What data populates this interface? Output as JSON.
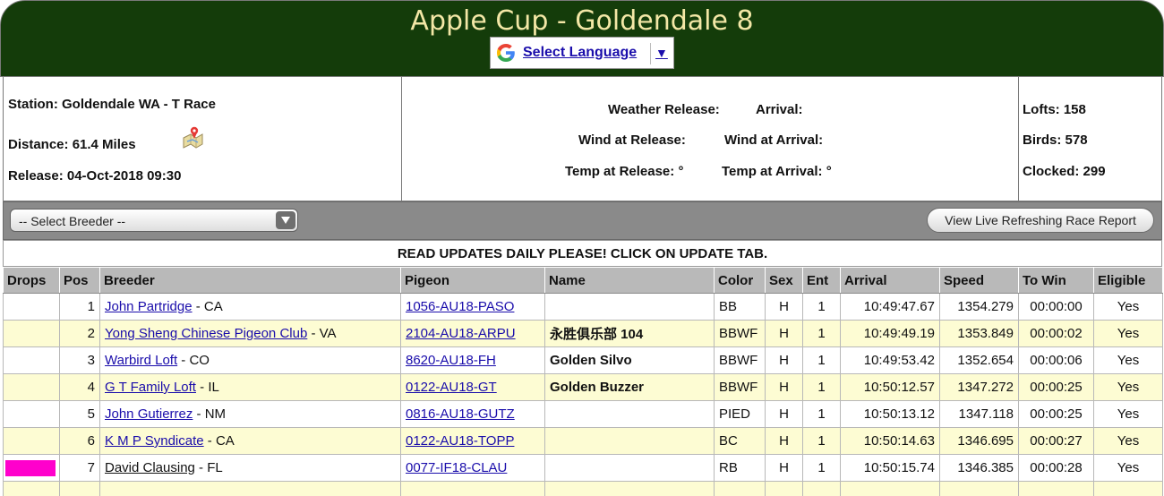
{
  "header": {
    "title": "Apple Cup - Goldendale 8",
    "language_label": "Select Language",
    "language_arrow": "▼"
  },
  "race_info": {
    "station": "Station: Goldendale WA - T Race",
    "distance": "Distance: 61.4 Miles",
    "release": "Release: 04-Oct-2018 09:30",
    "weather_release": "Weather Release:",
    "arrival": "Arrival:",
    "wind_release": "Wind at Release:",
    "wind_arrival": "Wind at Arrival:",
    "temp_release": "Temp at Release: °",
    "temp_arrival": "Temp at Arrival: °",
    "lofts": "Lofts: 158",
    "birds": "Birds: 578",
    "clocked": "Clocked: 299"
  },
  "toolbar": {
    "breeder_select": "-- Select Breeder --",
    "live_report_button": "View Live Refreshing Race Report"
  },
  "notice": "READ UPDATES DAILY PLEASE! CLICK ON UPDATE TAB.",
  "table": {
    "columns": [
      "Drops",
      "Pos",
      "Breeder",
      "Pigeon",
      "Name",
      "Color",
      "Sex",
      "Ent",
      "Arrival",
      "Speed",
      "To Win",
      "Eligible"
    ],
    "rows": [
      {
        "drops": "",
        "pos": "1",
        "breeder": "John Partridge",
        "state": " - CA",
        "pigeon": "1056-AU18-PASO",
        "name": "",
        "color": "BB",
        "sex": "H",
        "ent": "1",
        "arrival": "10:49:47.67",
        "speed": "1354.279",
        "to_win": "00:00:00",
        "eligible": "Yes"
      },
      {
        "drops": "",
        "pos": "2",
        "breeder": "Yong Sheng Chinese Pigeon Club",
        "state": " - VA",
        "pigeon": "2104-AU18-ARPU",
        "name": "永胜俱乐部 104",
        "color": "BBWF",
        "sex": "H",
        "ent": "1",
        "arrival": "10:49:49.19",
        "speed": "1353.849",
        "to_win": "00:00:02",
        "eligible": "Yes"
      },
      {
        "drops": "",
        "pos": "3",
        "breeder": "Warbird Loft",
        "state": " - CO",
        "pigeon": "8620-AU18-FH",
        "name": "Golden Silvo",
        "color": "BBWF",
        "sex": "H",
        "ent": "1",
        "arrival": "10:49:53.42",
        "speed": "1352.654",
        "to_win": "00:00:06",
        "eligible": "Yes"
      },
      {
        "drops": "",
        "pos": "4",
        "breeder": "G T Family Loft",
        "state": " - IL",
        "pigeon": "0122-AU18-GT",
        "name": "Golden Buzzer",
        "color": "BBWF",
        "sex": "H",
        "ent": "1",
        "arrival": "10:50:12.57",
        "speed": "1347.272",
        "to_win": "00:00:25",
        "eligible": "Yes"
      },
      {
        "drops": "",
        "pos": "5",
        "breeder": "John Gutierrez",
        "state": " - NM",
        "pigeon": "0816-AU18-GUTZ",
        "name": "",
        "color": "PIED",
        "sex": "H",
        "ent": "1",
        "arrival": "10:50:13.12",
        "speed": "1347.118",
        "to_win": "00:00:25",
        "eligible": "Yes"
      },
      {
        "drops": "",
        "pos": "6",
        "breeder": "K M P Syndicate",
        "state": " - CA",
        "pigeon": "0122-AU18-TOPP",
        "name": "",
        "color": "BC",
        "sex": "H",
        "ent": "1",
        "arrival": "10:50:14.63",
        "speed": "1346.695",
        "to_win": "00:00:27",
        "eligible": "Yes"
      },
      {
        "drops": "",
        "pos": "7",
        "breeder": "David Clausing",
        "state": " - FL",
        "pigeon": "0077-IF18-CLAU",
        "name": "",
        "color": "RB",
        "sex": "H",
        "ent": "1",
        "arrival": "10:50:15.74",
        "speed": "1346.385",
        "to_win": "00:00:28",
        "eligible": "Yes"
      }
    ]
  },
  "colors": {
    "header_bg": "#143c0a",
    "title": "#f3e7a6",
    "row_even": "#fdfcd3",
    "drop_marker": "#ff00cc",
    "link": "#1a0dab"
  },
  "icons": {
    "google": "google-g-icon",
    "map": "map-icon",
    "dropdown": "chevron-down-icon"
  }
}
